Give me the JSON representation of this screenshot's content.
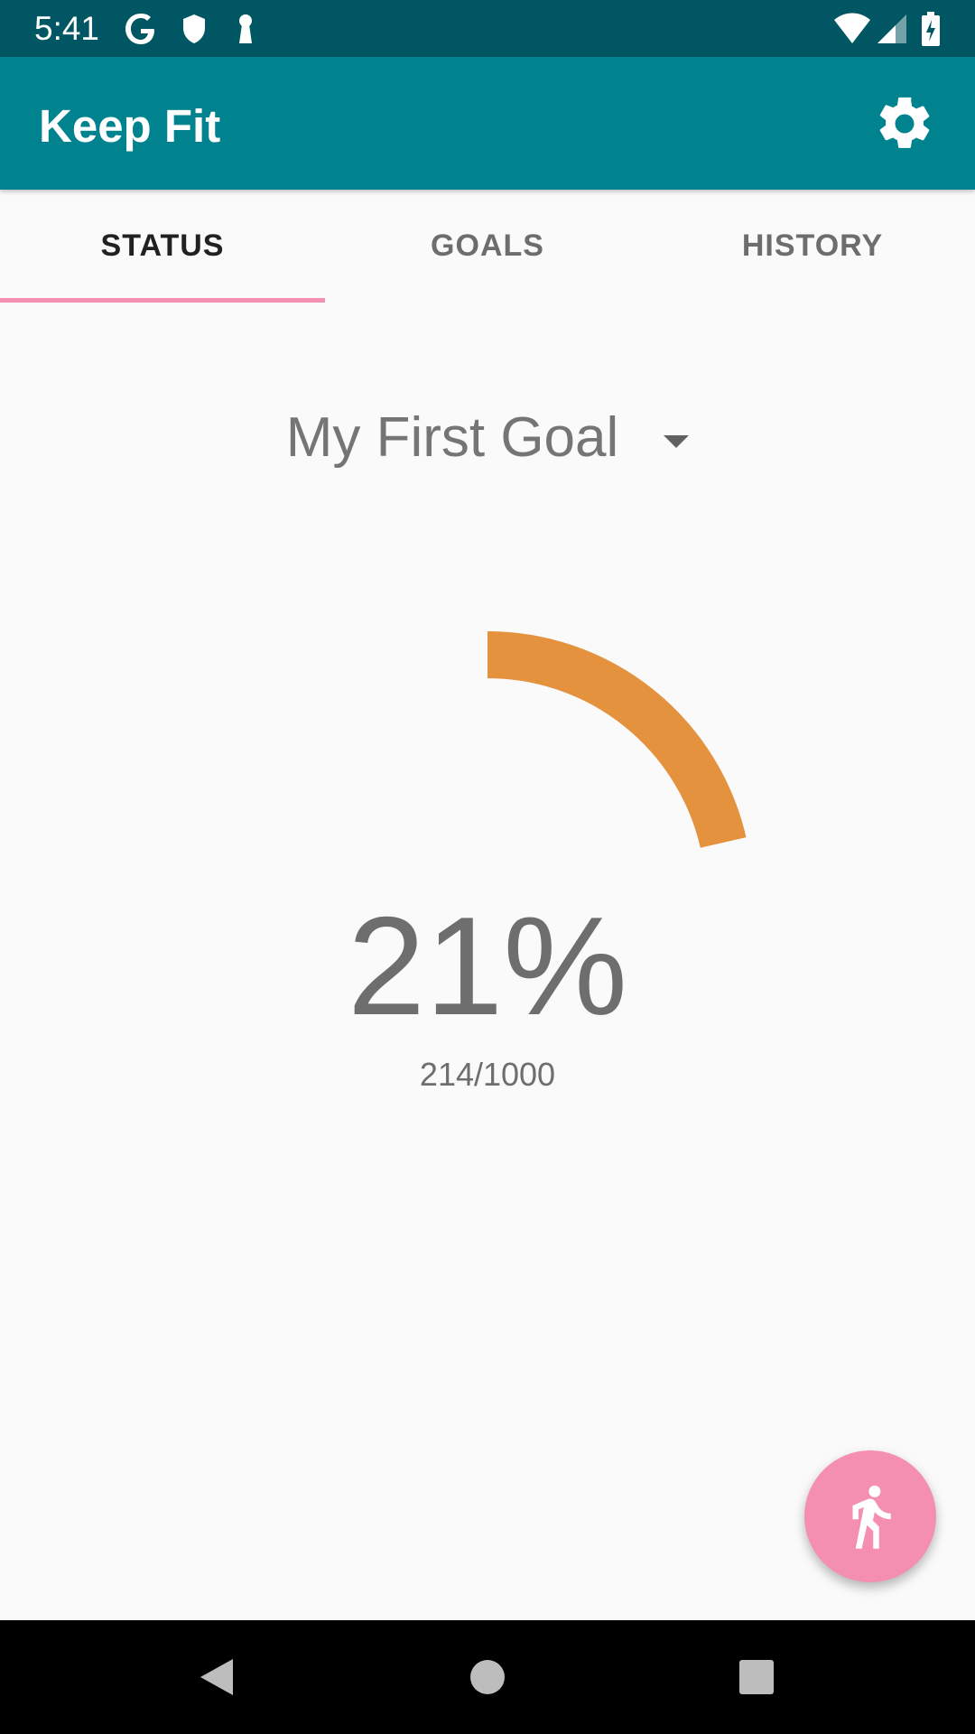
{
  "status_bar": {
    "time": "5:41",
    "icons_left": [
      "google-icon",
      "shield-icon",
      "keyhole-icon"
    ],
    "icons_right": [
      "wifi-icon",
      "cell-signal-icon",
      "battery-charging-icon"
    ]
  },
  "app_bar": {
    "title": "Keep Fit",
    "settings_icon": "gear-icon"
  },
  "tabs": [
    {
      "label": "STATUS",
      "active": true
    },
    {
      "label": "GOALS",
      "active": false
    },
    {
      "label": "HISTORY",
      "active": false
    }
  ],
  "goal_selector": {
    "selected": "My First Goal"
  },
  "progress": {
    "percent_label": "21%",
    "count_label": "214/1000",
    "fraction": 0.214,
    "color": "#e5923e"
  },
  "fab": {
    "icon": "walking-person-icon",
    "color": "#f48fb1"
  },
  "colors": {
    "status_bar": "#005662",
    "app_bar": "#00838f",
    "tab_indicator": "#f48fb1"
  },
  "nav_bar": {
    "icons": [
      "back-icon",
      "home-icon",
      "recents-icon"
    ]
  }
}
